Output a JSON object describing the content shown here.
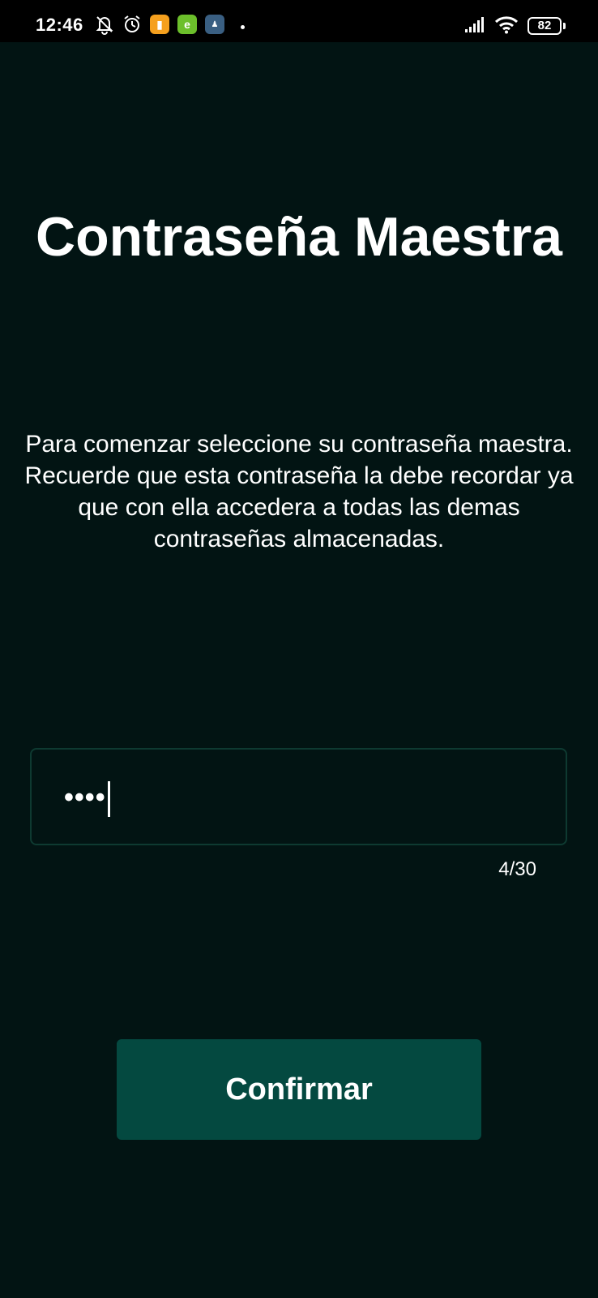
{
  "status_bar": {
    "time": "12:46",
    "battery": "82",
    "icons": [
      "notifications-off-icon",
      "alarm-icon",
      "app-notification-orange-icon",
      "app-notification-green-icon",
      "game-notification-icon",
      "signal-icon",
      "wifi-icon",
      "battery-icon"
    ],
    "colors": {
      "orange_app": "#f5a01e",
      "green_app": "#6cbf2b",
      "game_app": "#3a5f82"
    }
  },
  "screen": {
    "title": "Contraseña Maestra",
    "instructions": [
      "Para comenzar seleccione su contraseña maestra.",
      "Recuerde que esta contraseña la debe recordar ya que con ella accedera a todas las demas contraseñas almacenadas."
    ],
    "password_field": {
      "masked_value": "••••",
      "counter": "4/30"
    },
    "confirm_label": "Confirmar"
  },
  "colors": {
    "background": "#021413",
    "button": "#044940",
    "field_border": "#0e3a31",
    "text": "#ffffff"
  }
}
